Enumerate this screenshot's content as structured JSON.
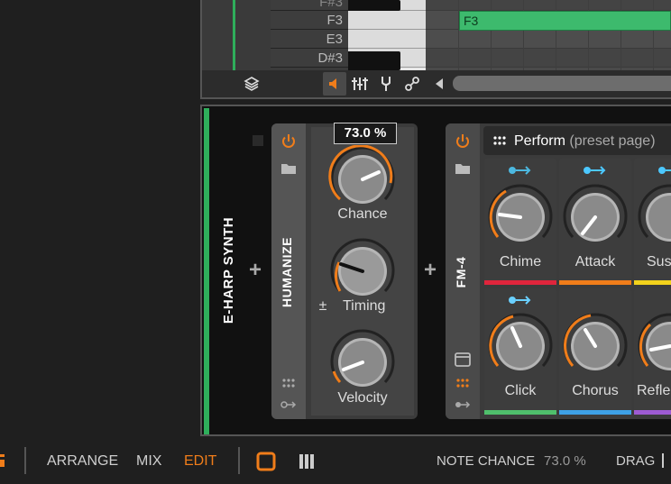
{
  "piano_roll": {
    "keys": [
      {
        "label": "F#3",
        "black": true
      },
      {
        "label": "F3",
        "black": false
      },
      {
        "label": "E3",
        "black": false
      },
      {
        "label": "D#3",
        "black": true
      }
    ],
    "note": {
      "label": "F3",
      "color": "#3dba6d"
    }
  },
  "track": {
    "name": "E-HARP SYNTH",
    "color": "#2fae5b"
  },
  "humanize": {
    "name": "HUMANIZE",
    "tooltip": "73.0 %",
    "knobs": [
      {
        "label": "Chance",
        "value": 0.73
      },
      {
        "label": "Timing",
        "value": 0.0,
        "prefix": "±"
      },
      {
        "label": "Velocity",
        "value": 0.2
      }
    ]
  },
  "fm4": {
    "name": "FM-4",
    "header_title": "Perform",
    "header_sub": "(preset page)",
    "cells": [
      {
        "label": "Chime",
        "bar_color": "#e0253c",
        "value": 0.3
      },
      {
        "label": "Attack",
        "bar_color": "#f07d1a",
        "value": 0.62
      },
      {
        "label": "Sust",
        "bar_color": "#f2d21c",
        "value": 0.5
      },
      {
        "label": "Click",
        "bar_color": "#4fbf6c",
        "value": 0.43
      },
      {
        "label": "Chorus",
        "bar_color": "#3ea1e6",
        "value": 0.45
      },
      {
        "label": "Refle",
        "bar_color": "#9d5bd2",
        "value": 0.3
      }
    ]
  },
  "accent": "#f07d1a",
  "bottom_bar": {
    "views": [
      "ARRANGE",
      "MIX",
      "EDIT"
    ],
    "active_view": "EDIT",
    "status_label": "NOTE CHANCE",
    "status_value": "73.0 %",
    "drag_label": "DRAG"
  }
}
